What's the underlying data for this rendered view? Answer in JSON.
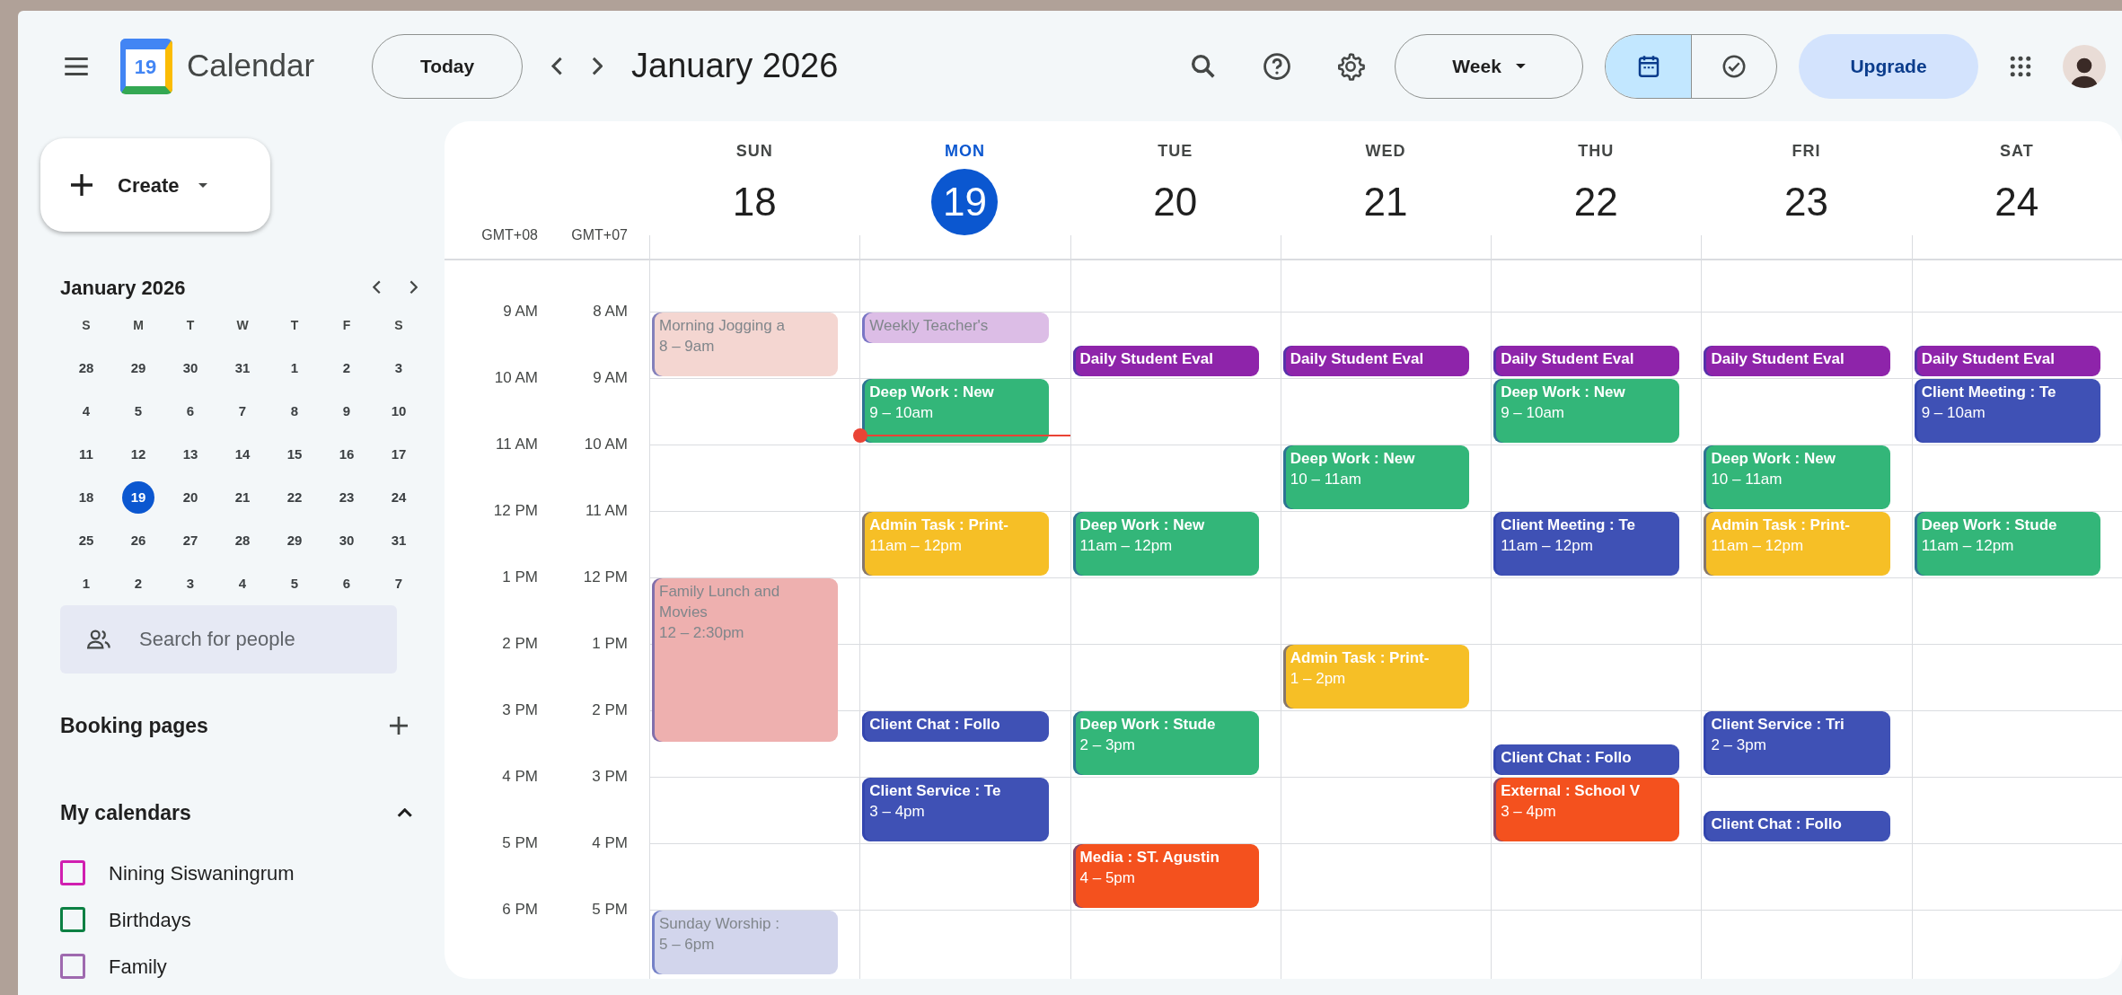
{
  "app": {
    "title": "Calendar",
    "logo_date": "19"
  },
  "toolbar": {
    "today": "Today",
    "period": "January 2026",
    "view": "Week",
    "upgrade": "Upgrade",
    "view_toggle": [
      {
        "kind": "calendar",
        "selected": true
      },
      {
        "kind": "tasks",
        "selected": false
      }
    ]
  },
  "sidebar": {
    "create": "Create",
    "mini_calendar": {
      "month": "January 2026",
      "weekdays": [
        "S",
        "M",
        "T",
        "W",
        "T",
        "F",
        "S"
      ],
      "weeks": [
        [
          {
            "d": "28",
            "selected": false
          },
          {
            "d": "29",
            "selected": false
          },
          {
            "d": "30",
            "selected": false
          },
          {
            "d": "31",
            "selected": false
          },
          {
            "d": "1",
            "selected": false
          },
          {
            "d": "2",
            "selected": false
          },
          {
            "d": "3",
            "selected": false
          }
        ],
        [
          {
            "d": "4",
            "selected": false
          },
          {
            "d": "5",
            "selected": false
          },
          {
            "d": "6",
            "selected": false
          },
          {
            "d": "7",
            "selected": false
          },
          {
            "d": "8",
            "selected": false
          },
          {
            "d": "9",
            "selected": false
          },
          {
            "d": "10",
            "selected": false
          }
        ],
        [
          {
            "d": "11",
            "selected": false
          },
          {
            "d": "12",
            "selected": false
          },
          {
            "d": "13",
            "selected": false
          },
          {
            "d": "14",
            "selected": false
          },
          {
            "d": "15",
            "selected": false
          },
          {
            "d": "16",
            "selected": false
          },
          {
            "d": "17",
            "selected": false
          }
        ],
        [
          {
            "d": "18",
            "selected": false
          },
          {
            "d": "19",
            "selected": true
          },
          {
            "d": "20",
            "selected": false
          },
          {
            "d": "21",
            "selected": false
          },
          {
            "d": "22",
            "selected": false
          },
          {
            "d": "23",
            "selected": false
          },
          {
            "d": "24",
            "selected": false
          }
        ],
        [
          {
            "d": "25",
            "selected": false
          },
          {
            "d": "26",
            "selected": false
          },
          {
            "d": "27",
            "selected": false
          },
          {
            "d": "28",
            "selected": false
          },
          {
            "d": "29",
            "selected": false
          },
          {
            "d": "30",
            "selected": false
          },
          {
            "d": "31",
            "selected": false
          }
        ],
        [
          {
            "d": "1",
            "selected": false
          },
          {
            "d": "2",
            "selected": false
          },
          {
            "d": "3",
            "selected": false
          },
          {
            "d": "4",
            "selected": false
          },
          {
            "d": "5",
            "selected": false
          },
          {
            "d": "6",
            "selected": false
          },
          {
            "d": "7",
            "selected": false
          }
        ]
      ]
    },
    "people_search": {
      "placeholder": "Search for people"
    },
    "booking_pages": "Booking pages",
    "my_calendars": {
      "label": "My calendars",
      "expanded": true,
      "items": [
        {
          "name": "Nining Siswaningrum",
          "color": "#d01fb0",
          "checked": false
        },
        {
          "name": "Birthdays",
          "color": "#0b8043",
          "checked": false
        },
        {
          "name": "Family",
          "color": "#9e69af",
          "checked": false
        }
      ]
    }
  },
  "week": {
    "timezones": [
      "GMT+08",
      "GMT+07"
    ],
    "days": [
      {
        "weekday": "SUN",
        "date": "18",
        "selected": false,
        "now_line": false
      },
      {
        "weekday": "MON",
        "date": "19",
        "selected": true,
        "now_line": true
      },
      {
        "weekday": "TUE",
        "date": "20",
        "selected": false,
        "now_line": false
      },
      {
        "weekday": "WED",
        "date": "21",
        "selected": false,
        "now_line": false
      },
      {
        "weekday": "THU",
        "date": "22",
        "selected": false,
        "now_line": false
      },
      {
        "weekday": "FRI",
        "date": "23",
        "selected": false,
        "now_line": false
      },
      {
        "weekday": "SAT",
        "date": "24",
        "selected": false,
        "now_line": false
      }
    ],
    "time_rows": [
      {
        "labels": [
          "9 AM",
          "8 AM"
        ],
        "cells": [
          [
            {
              "title": "Morning Jogging a",
              "time": "8 – 9am",
              "kind": "hour",
              "color": "#f4d6d1",
              "past": true,
              "half_past": false
            }
          ],
          [
            {
              "title": "Weekly Teacher's",
              "kind": "half",
              "color": "#dcbde6",
              "past": true,
              "half_past": false
            }
          ],
          [
            {
              "title": "Daily Student Eval",
              "kind": "half",
              "color": "#8e24aa",
              "past": false,
              "half_past": true
            }
          ],
          [
            {
              "title": "Daily Student Eval",
              "kind": "half",
              "color": "#8e24aa",
              "past": false,
              "half_past": true
            }
          ],
          [
            {
              "title": "Daily Student Eval",
              "kind": "half",
              "color": "#8e24aa",
              "past": false,
              "half_past": true
            }
          ],
          [
            {
              "title": "Daily Student Eval",
              "kind": "half",
              "color": "#8e24aa",
              "past": false,
              "half_past": true
            }
          ],
          [
            {
              "title": "Daily Student Eval",
              "kind": "half",
              "color": "#8e24aa",
              "past": false,
              "half_past": true
            }
          ]
        ]
      },
      {
        "labels": [
          "10 AM",
          "9 AM"
        ],
        "cells": [
          [],
          [
            {
              "title": "Deep Work : New",
              "time": "9 – 10am",
              "kind": "hour",
              "color": "#33b679",
              "past": false,
              "half_past": false
            }
          ],
          [],
          [],
          [
            {
              "title": "Deep Work : New",
              "time": "9 – 10am",
              "kind": "hour",
              "color": "#33b679",
              "past": false,
              "half_past": false
            }
          ],
          [],
          [
            {
              "title": "Client Meeting : Te",
              "time": "9 – 10am",
              "kind": "hour",
              "color": "#3f51b5",
              "past": false,
              "half_past": false
            }
          ]
        ]
      },
      {
        "labels": [
          "11 AM",
          "10 AM"
        ],
        "cells": [
          [],
          [],
          [],
          [
            {
              "title": "Deep Work : New",
              "time": "10 – 11am",
              "kind": "hour",
              "color": "#33b679",
              "past": false,
              "half_past": false
            }
          ],
          [],
          [
            {
              "title": "Deep Work : New",
              "time": "10 – 11am",
              "kind": "hour",
              "color": "#33b679",
              "past": false,
              "half_past": false
            }
          ],
          []
        ]
      },
      {
        "labels": [
          "12 PM",
          "11 AM"
        ],
        "cells": [
          [],
          [
            {
              "title": "Admin Task : Print-",
              "time": "11am – 12pm",
              "kind": "hour",
              "color": "#f6bf26",
              "past": false,
              "half_past": false
            }
          ],
          [
            {
              "title": "Deep Work : New",
              "time": "11am – 12pm",
              "kind": "hour",
              "color": "#33b679",
              "past": false,
              "half_past": false
            }
          ],
          [],
          [
            {
              "title": "Client Meeting : Te",
              "time": "11am – 12pm",
              "kind": "hour",
              "color": "#3f51b5",
              "past": false,
              "half_past": false
            }
          ],
          [
            {
              "title": "Admin Task : Print-",
              "time": "11am – 12pm",
              "kind": "hour",
              "color": "#f6bf26",
              "past": false,
              "half_past": false
            }
          ],
          [
            {
              "title": "Deep Work : Stude",
              "time": "11am – 12pm",
              "kind": "hour",
              "color": "#33b679",
              "past": false,
              "half_past": false
            }
          ]
        ]
      },
      {
        "labels": [
          "1 PM",
          "12 PM"
        ],
        "cells": [
          [
            {
              "title": "Family Lunch and Movies",
              "time": "12 – 2:30pm",
              "kind": "long",
              "color": "#eeb0af",
              "past": true,
              "half_past": false
            }
          ],
          [],
          [],
          [],
          [],
          [],
          []
        ]
      },
      {
        "labels": [
          "2 PM",
          "1 PM"
        ],
        "cells": [
          [],
          [],
          [],
          [
            {
              "title": "Admin Task : Print-",
              "time": "1 – 2pm",
              "kind": "hour",
              "color": "#f6bf26",
              "past": false,
              "half_past": false
            }
          ],
          [],
          [],
          []
        ]
      },
      {
        "labels": [
          "3 PM",
          "2 PM"
        ],
        "cells": [
          [],
          [
            {
              "title": "Client Chat : Follo",
              "kind": "half",
              "color": "#3f51b5",
              "past": false,
              "half_past": false
            }
          ],
          [
            {
              "title": "Deep Work : Stude",
              "time": "2 – 3pm",
              "kind": "hour",
              "color": "#33b679",
              "past": false,
              "half_past": false
            }
          ],
          [],
          [
            {
              "title": "Client Chat : Follo",
              "kind": "half",
              "color": "#3f51b5",
              "past": false,
              "half_past": true
            }
          ],
          [
            {
              "title": "Client Service : Tri",
              "time": "2 – 3pm",
              "kind": "hour",
              "color": "#3f51b5",
              "past": false,
              "half_past": false
            }
          ],
          []
        ]
      },
      {
        "labels": [
          "4 PM",
          "3 PM"
        ],
        "cells": [
          [],
          [
            {
              "title": "Client Service : Te",
              "time": "3 – 4pm",
              "kind": "hour",
              "color": "#3f51b5",
              "past": false,
              "half_past": false
            }
          ],
          [],
          [],
          [
            {
              "title": "External : School V",
              "time": "3 – 4pm",
              "kind": "hour",
              "color": "#f4511e",
              "past": false,
              "half_past": false
            }
          ],
          [
            {
              "title": "Client Chat : Follo",
              "kind": "half",
              "color": "#3f51b5",
              "past": false,
              "half_past": true
            }
          ],
          []
        ]
      },
      {
        "labels": [
          "5 PM",
          "4 PM"
        ],
        "cells": [
          [],
          [],
          [
            {
              "title": "Media : ST. Agustin",
              "time": "4 – 5pm",
              "kind": "hour",
              "color": "#f4511e",
              "past": false,
              "half_past": false
            }
          ],
          [],
          [],
          [],
          []
        ]
      },
      {
        "labels": [
          "6 PM",
          "5 PM"
        ],
        "cells": [
          [
            {
              "title": "Sunday Worship :",
              "time": "5 – 6pm",
              "kind": "hour",
              "color": "#d2d5ec",
              "past": true,
              "half_past": false
            }
          ],
          [],
          [],
          [],
          [],
          [],
          []
        ]
      }
    ]
  }
}
